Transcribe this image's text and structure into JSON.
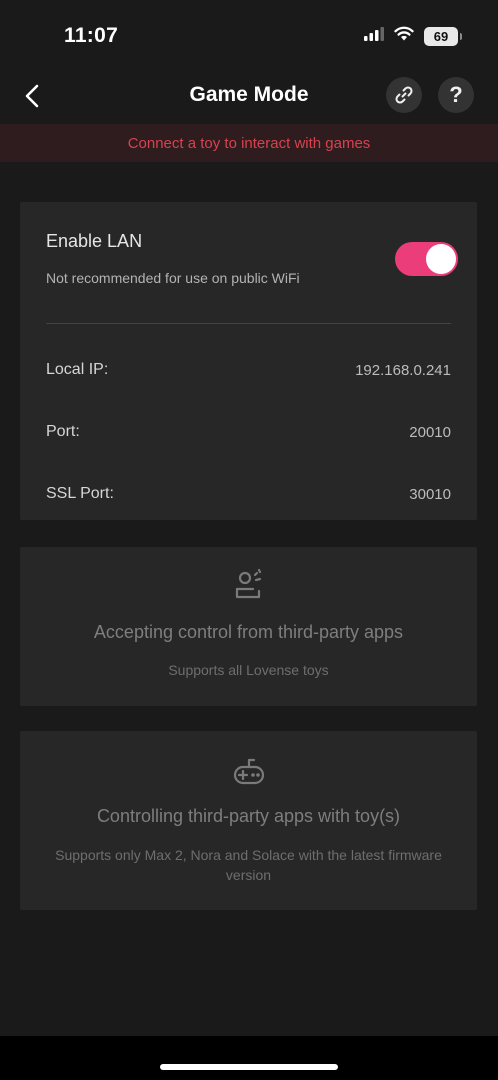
{
  "status_bar": {
    "time": "11:07",
    "battery": "69",
    "icons": [
      "signal-icon",
      "wifi-icon",
      "battery-icon"
    ]
  },
  "nav": {
    "title": "Game Mode",
    "icons": [
      "back-icon",
      "link-icon",
      "help-icon"
    ],
    "help_label": "?"
  },
  "banner": {
    "text": "Connect a toy to interact with games",
    "color": "#d8424d"
  },
  "lan": {
    "title": "Enable LAN",
    "subtitle": "Not recommended for use on public WiFi",
    "enabled": true,
    "toggle_color": "#ec3d7b",
    "rows": [
      {
        "label": "Local IP:",
        "value": "192.168.0.241"
      },
      {
        "label": "Port:",
        "value": "20010"
      },
      {
        "label": "SSL Port:",
        "value": "30010"
      }
    ]
  },
  "features": [
    {
      "icon": "person-control-icon",
      "title": "Accepting control from third-party apps",
      "subtitle": "Supports all Lovense toys"
    },
    {
      "icon": "gamepad-icon",
      "title": "Controlling third-party apps with toy(s)",
      "subtitle": "Supports only Max 2, Nora and Solace with the latest firmware version"
    }
  ]
}
